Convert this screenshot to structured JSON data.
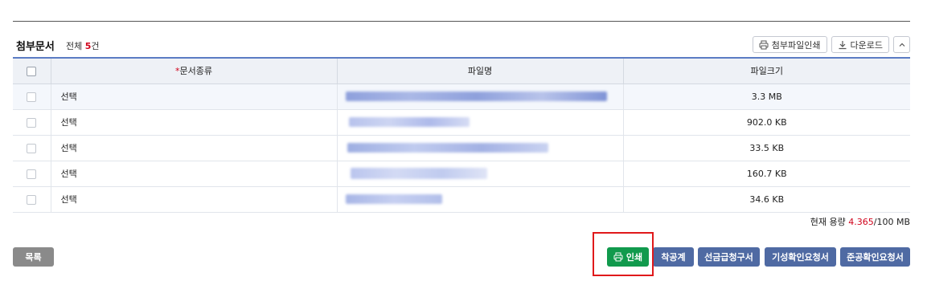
{
  "section": {
    "title": "첨부문서",
    "total_label": "전체",
    "total_count": "5",
    "total_unit": "건"
  },
  "header_actions": {
    "print_attachments": "첨부파일인쇄",
    "download": "다운로드",
    "collapse_icon": "chevron-up-icon"
  },
  "table": {
    "columns": {
      "required_mark": "*",
      "doc_type": "문서종류",
      "file_name": "파일명",
      "file_size": "파일크기"
    },
    "rows": [
      {
        "doc_type": "선택",
        "file_size": "3.3 MB"
      },
      {
        "doc_type": "선택",
        "file_size": "902.0 KB"
      },
      {
        "doc_type": "선택",
        "file_size": "33.5 KB"
      },
      {
        "doc_type": "선택",
        "file_size": "160.7 KB"
      },
      {
        "doc_type": "선택",
        "file_size": "34.6 KB"
      }
    ]
  },
  "capacity": {
    "label": "현재 용량",
    "used": "4.365",
    "total": "/100 MB"
  },
  "footer": {
    "list": "목록",
    "print": "인쇄",
    "start_notice": "착공계",
    "advance_claim": "선금급청구서",
    "progress_check": "기성확인요청서",
    "completion_check": "준공확인요청서"
  },
  "colors": {
    "accent_blue": "#4f6aa3",
    "print_green": "#119a4d",
    "highlight_red": "#e0191b"
  }
}
